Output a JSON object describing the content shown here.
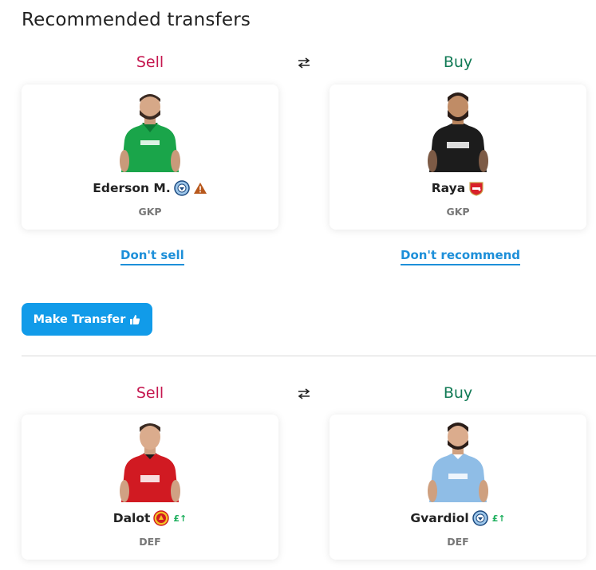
{
  "page": {
    "title": "Recommended transfers"
  },
  "transfers": [
    {
      "sell_label": "Sell",
      "buy_label": "Buy",
      "sell": {
        "name": "Ederson M.",
        "position": "GKP",
        "club_crest": "man-city-crest",
        "flag": "warning-icon",
        "kit_color": "#1aa54a"
      },
      "buy": {
        "name": "Raya",
        "position": "GKP",
        "club_crest": "arsenal-crest",
        "kit_color": "#1c1c1c"
      },
      "dont_sell_label": "Don't sell",
      "dont_recommend_label": "Don't recommend"
    },
    {
      "sell_label": "Sell",
      "buy_label": "Buy",
      "sell": {
        "name": "Dalot",
        "position": "DEF",
        "club_crest": "man-utd-crest",
        "price_change": "£↑",
        "kit_color": "#d11a22"
      },
      "buy": {
        "name": "Gvardiol",
        "position": "DEF",
        "club_crest": "man-city-crest",
        "price_change": "£↑",
        "kit_color": "#8fbde6"
      }
    }
  ],
  "actions": {
    "make_transfer_label": "Make Transfer",
    "make_transfer_icon": "thumbs-up-icon"
  },
  "colors": {
    "sell": "#c5174f",
    "buy": "#117a55",
    "link": "#1d8fd9",
    "button": "#119be9",
    "price_up": "#1cae5c"
  }
}
